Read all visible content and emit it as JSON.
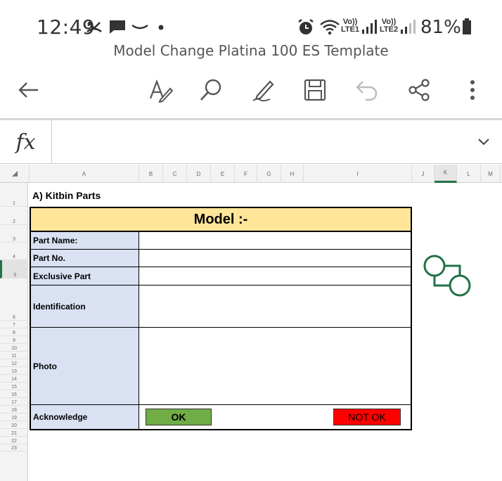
{
  "status_bar": {
    "time": "12:49",
    "battery": "81%",
    "sim1": "Vo))\nLTE1",
    "sim2": "Vo))\nLTE2"
  },
  "file_title": "Model Change Platina 100 ES Template",
  "toolbar": {
    "icons": [
      "back-arrow-icon",
      "text-format-icon",
      "search-icon",
      "draw-pen-icon",
      "save-icon",
      "undo-icon",
      "share-icon",
      "more-vert-icon"
    ]
  },
  "formula_bar": {
    "label": "fx",
    "value": ""
  },
  "columns": [
    "A",
    "B",
    "C",
    "D",
    "E",
    "F",
    "G",
    "H",
    "I",
    "J",
    "K",
    "L",
    "M"
  ],
  "selected_column": "K",
  "rows": [
    "1",
    "2",
    "3",
    "4",
    "5",
    "6",
    "7",
    "8",
    "9",
    "10",
    "11",
    "12",
    "13",
    "14",
    "15",
    "16",
    "17",
    "18",
    "19",
    "20",
    "21",
    "22",
    "23"
  ],
  "active_row": "5",
  "sheet": {
    "section_title": "A) Kitbin Parts",
    "model_label": "Model :-",
    "fields": [
      {
        "label": "Part Name:",
        "value": ""
      },
      {
        "label": "Part No.",
        "value": ""
      },
      {
        "label": "Exclusive Part",
        "value": ""
      },
      {
        "label": "Identification",
        "value": ""
      },
      {
        "label": "Photo",
        "value": ""
      },
      {
        "label": "Acknowledge",
        "value": ""
      }
    ],
    "ok_label": "OK",
    "not_ok_label": "NOT OK"
  },
  "colors": {
    "accent": "#217346",
    "model_fill": "#ffe598",
    "label_fill": "#d9e1f2",
    "ok_fill": "#70ad47",
    "not_ok_fill": "#ff0000"
  }
}
